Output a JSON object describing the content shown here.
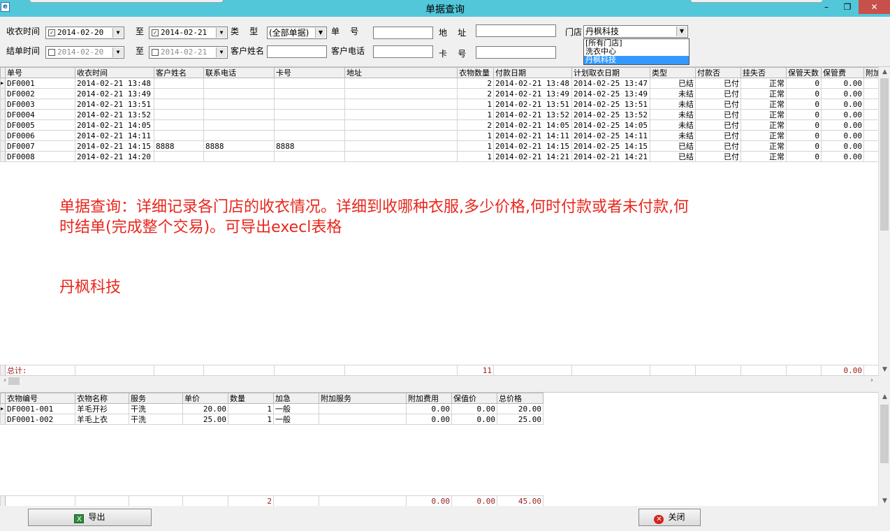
{
  "window": {
    "title": "单据查询",
    "app_icon": "ie-icon",
    "controls": {
      "minimize": "–",
      "restore": "❐",
      "close": "✕"
    }
  },
  "filters": {
    "receive_time_label": "收衣时间",
    "receive_from": "2014-02-20",
    "receive_to": "2014-02-21",
    "to_label": "至",
    "type_label": "类    型",
    "type_value": "(全部单据)",
    "order_no_label": "单    号",
    "address_label": "地    址",
    "store_label": "门店",
    "store_value": "丹枫科技",
    "store_options": [
      "[所有门店]",
      "洗衣中心",
      "丹枫科技"
    ],
    "settle_time_label": "结单时间",
    "settle_from": "2014-02-20",
    "settle_to": "2014-02-21",
    "customer_name_label": "客户姓名",
    "customer_phone_label": "客户电话",
    "card_no_label": "卡    号"
  },
  "orders": {
    "columns": [
      "单号",
      "收衣时间",
      "客户姓名",
      "联系电话",
      "卡号",
      "地址",
      "衣物数量",
      "付款日期",
      "计划取衣日期",
      "类型",
      "付款否",
      "挂失否",
      "保管天数",
      "保管费",
      "附加"
    ],
    "rows": [
      [
        "DF0001",
        "2014-02-21 13:48",
        "",
        "",
        "",
        "",
        "2",
        "2014-02-21 13:48",
        "2014-02-25 13:47",
        "已结",
        "已付",
        "正常",
        "0",
        "0.00"
      ],
      [
        "DF0002",
        "2014-02-21 13:49",
        "",
        "",
        "",
        "",
        "2",
        "2014-02-21 13:49",
        "2014-02-25 13:49",
        "未结",
        "已付",
        "正常",
        "0",
        "0.00"
      ],
      [
        "DF0003",
        "2014-02-21 13:51",
        "",
        "",
        "",
        "",
        "1",
        "2014-02-21 13:51",
        "2014-02-25 13:51",
        "未结",
        "已付",
        "正常",
        "0",
        "0.00"
      ],
      [
        "DF0004",
        "2014-02-21 13:52",
        "",
        "",
        "",
        "",
        "1",
        "2014-02-21 13:52",
        "2014-02-25 13:52",
        "未结",
        "已付",
        "正常",
        "0",
        "0.00"
      ],
      [
        "DF0005",
        "2014-02-21 14:05",
        "",
        "",
        "",
        "",
        "2",
        "2014-02-21 14:05",
        "2014-02-25 14:05",
        "未结",
        "已付",
        "正常",
        "0",
        "0.00"
      ],
      [
        "DF0006",
        "2014-02-21 14:11",
        "",
        "",
        "",
        "",
        "1",
        "2014-02-21 14:11",
        "2014-02-25 14:11",
        "未结",
        "已付",
        "正常",
        "0",
        "0.00"
      ],
      [
        "DF0007",
        "2014-02-21 14:15",
        "8888",
        "8888",
        "8888",
        "",
        "1",
        "2014-02-21 14:15",
        "2014-02-25 14:15",
        "已结",
        "已付",
        "正常",
        "0",
        "0.00"
      ],
      [
        "DF0008",
        "2014-02-21 14:20",
        "",
        "",
        "",
        "",
        "1",
        "2014-02-21 14:21",
        "2014-02-21 14:21",
        "已结",
        "已付",
        "正常",
        "0",
        "0.00"
      ]
    ],
    "totals": [
      "总计:",
      "",
      "",
      "",
      "",
      "",
      "11",
      "",
      "",
      "",
      "",
      "",
      "",
      "0.00"
    ]
  },
  "annotation": {
    "line1": "单据查询：详细记录各门店的收衣情况。详细到收哪种衣服,多少价格,何时付款或者未付款,何",
    "line2": "时结单(完成整个交易)。可导出execl表格",
    "brand": "丹枫科技"
  },
  "items": {
    "columns": [
      "衣物编号",
      "衣物名称",
      "服务",
      "单价",
      "数量",
      "加急",
      "附加服务",
      "附加费用",
      "保值价",
      "总价格"
    ],
    "rows": [
      [
        "DF0001-001",
        "羊毛开衫",
        "干洗",
        "20.00",
        "1",
        "一般",
        "",
        "0.00",
        "0.00",
        "20.00"
      ],
      [
        "DF0001-002",
        "羊毛上衣",
        "干洗",
        "25.00",
        "1",
        "一般",
        "",
        "0.00",
        "0.00",
        "25.00"
      ]
    ],
    "totals": [
      "",
      "",
      "",
      "",
      "2",
      "",
      "",
      "0.00",
      "0.00",
      "45.00"
    ]
  },
  "buttons": {
    "export": "导出",
    "close": "关闭"
  },
  "colors": {
    "titlebar": "#52c7da",
    "annotation": "#e8271d",
    "totals": "#9b1c1c",
    "selection": "#3399ff"
  }
}
